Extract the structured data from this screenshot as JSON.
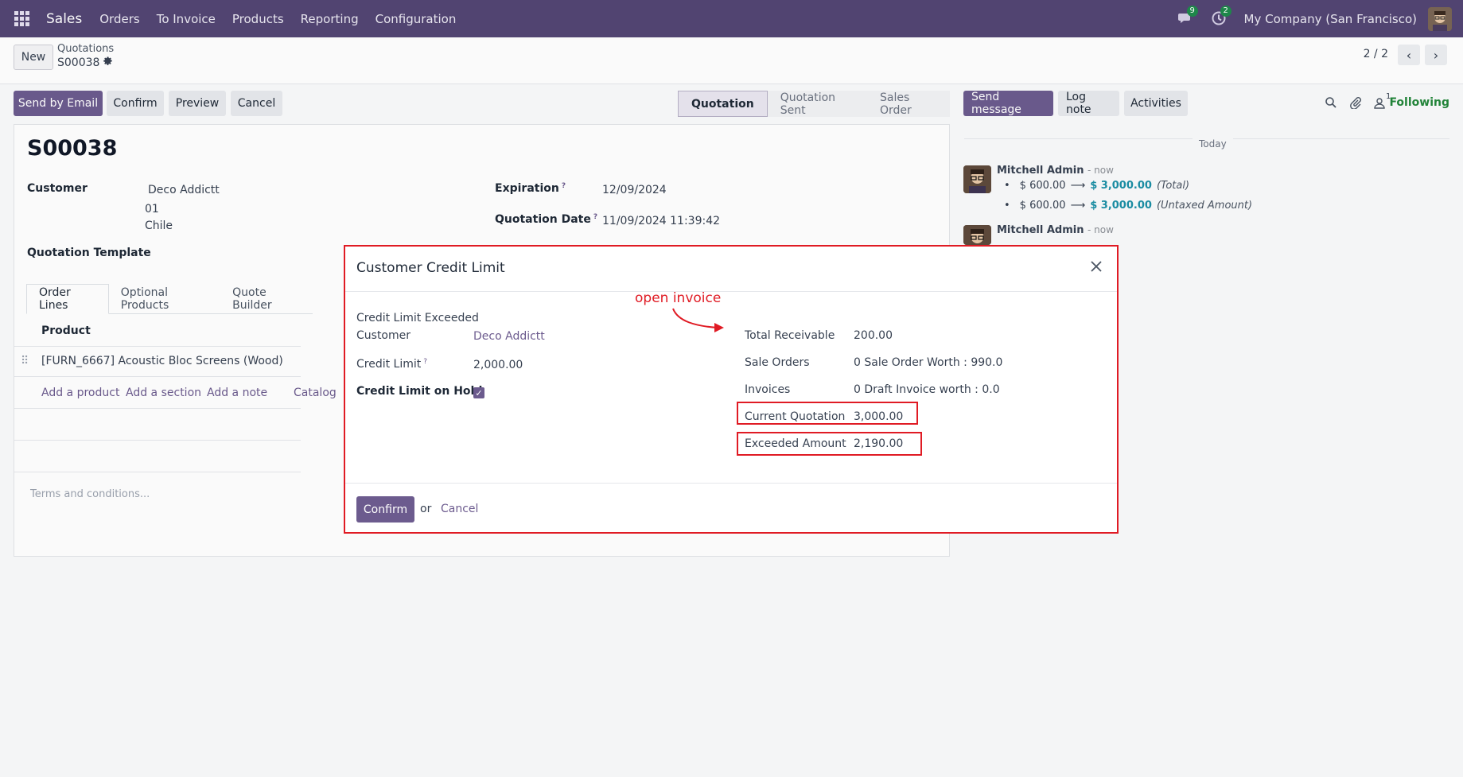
{
  "navbar": {
    "app_name": "Sales",
    "menu": [
      "Orders",
      "To Invoice",
      "Products",
      "Reporting",
      "Configuration"
    ],
    "messages_badge": "9",
    "activities_badge": "2",
    "company": "My Company (San Francisco)"
  },
  "control_panel": {
    "new_label": "New",
    "breadcrumb_parent": "Quotations",
    "breadcrumb_current": "S00038",
    "pager": "2 / 2"
  },
  "actions": {
    "send_email": "Send by Email",
    "confirm": "Confirm",
    "preview": "Preview",
    "cancel": "Cancel"
  },
  "statusbar": {
    "stages": [
      "Quotation",
      "Quotation Sent",
      "Sales Order"
    ],
    "active": "Quotation"
  },
  "form": {
    "title": "S00038",
    "customer_label": "Customer",
    "customer_name": "Deco Addictt",
    "customer_line2": "01",
    "customer_line3": "Chile",
    "template_label": "Quotation Template",
    "expiration_label": "Expiration",
    "expiration_value": "12/09/2024",
    "qdate_label": "Quotation Date",
    "qdate_value": "11/09/2024 11:39:42",
    "tabs": [
      "Order Lines",
      "Optional Products",
      "Quote Builder"
    ],
    "col_product": "Product",
    "line_product": "[FURN_6667] Acoustic Bloc Screens (Wood)",
    "add_product": "Add a product",
    "add_section": "Add a section",
    "add_note": "Add a note",
    "catalog": "Catalog",
    "terms_placeholder": "Terms and conditions..."
  },
  "chatter": {
    "send_message": "Send message",
    "log_note": "Log note",
    "activities": "Activities",
    "followers_count": "1",
    "following": "Following",
    "today": "Today",
    "msg1_author": "Mitchell Admin",
    "msg1_time": "- now",
    "msg1_line1_old": "$ 600.00",
    "msg1_line1_new": "$ 3,000.00",
    "msg1_line1_field": "(Total)",
    "msg1_line2_old": "$ 600.00",
    "msg1_line2_new": "$ 3,000.00",
    "msg1_line2_field": "(Untaxed Amount)",
    "msg2_author": "Mitchell Admin",
    "msg2_time": "- now"
  },
  "modal": {
    "title": "Customer Credit Limit",
    "exceeded_label": "Credit Limit Exceeded",
    "customer_label": "Customer",
    "customer_value": "Deco Addictt",
    "credit_limit_label": "Credit Limit",
    "credit_limit_value": "2,000.00",
    "on_hold_label": "Credit Limit on Hold",
    "on_hold_checked": true,
    "total_receivable_label": "Total Receivable",
    "total_receivable_value": "200.00",
    "sale_orders_label": "Sale Orders",
    "sale_orders_value": "0 Sale Order Worth : 990.0",
    "invoices_label": "Invoices",
    "invoices_value": "0 Draft Invoice worth : 0.0",
    "current_quotation_label": "Current Quotation",
    "current_quotation_value": "3,000.00",
    "exceeded_amount_label": "Exceeded Amount",
    "exceeded_amount_value": "2,190.00",
    "annotation": "open invoice",
    "confirm": "Confirm",
    "or": "or",
    "cancel": "Cancel"
  },
  "colors": {
    "navbar": "#534674",
    "primary": "#6c5b8e",
    "annotation_red": "#e01b24",
    "following_green": "#22863a"
  }
}
